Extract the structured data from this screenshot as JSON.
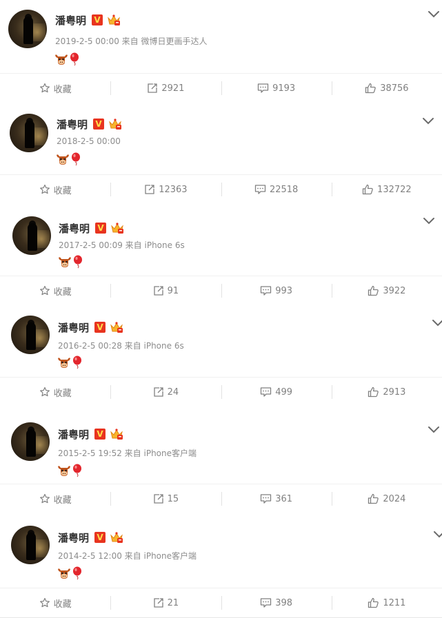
{
  "author": "潘粤明",
  "vip_badge": "V",
  "labels": {
    "favorite": "收藏"
  },
  "posts": [
    {
      "meta": "2019-2-5 00:00 来自 微博日更画手达人",
      "repost": "2921",
      "comment": "9193",
      "like": "38756"
    },
    {
      "meta": "2018-2-5 00:00",
      "repost": "12363",
      "comment": "22518",
      "like": "132722"
    },
    {
      "meta": "2017-2-5 00:09 来自 iPhone 6s",
      "repost": "91",
      "comment": "993",
      "like": "3922"
    },
    {
      "meta": "2016-2-5 00:28 来自 iPhone 6s",
      "repost": "24",
      "comment": "499",
      "like": "2913"
    },
    {
      "meta": "2015-2-5 19:52 来自 iPhone客户端",
      "repost": "15",
      "comment": "361",
      "like": "2024"
    },
    {
      "meta": "2014-2-5 12:00 来自 iPhone客户端",
      "repost": "21",
      "comment": "398",
      "like": "1211"
    }
  ],
  "icons": {
    "favorite": "star-icon",
    "repost": "repost-icon",
    "comment": "comment-icon",
    "like": "thumbs-up-icon",
    "more": "chevron-down-icon",
    "emoji_ox": "ox-emoji-icon",
    "emoji_balloon": "balloon-emoji-icon",
    "vip": "verified-v-icon",
    "member": "crown-member-icon"
  },
  "colors": {
    "vip_red": "#e8341f",
    "vip_gold": "#ffde4a",
    "meta_gray": "#8c8c8c",
    "divider_blue": "#d6e9f2"
  }
}
